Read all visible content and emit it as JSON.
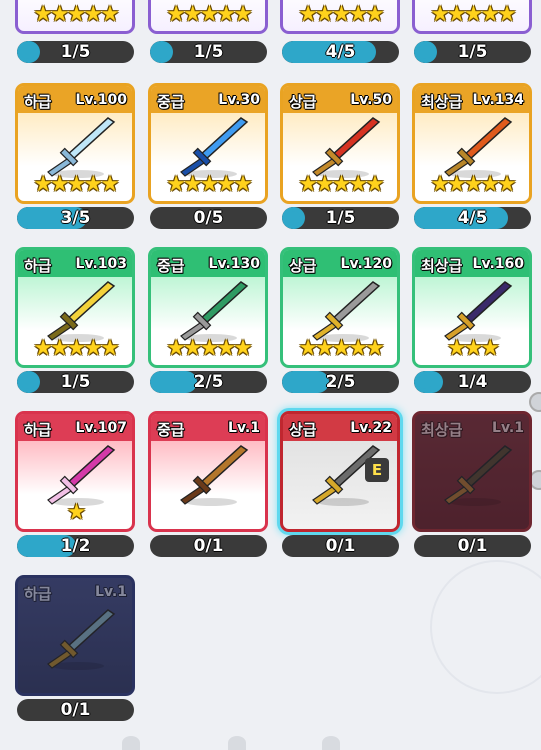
{
  "colors": {
    "purple": "#8a5fd1",
    "orange": "#e9a322",
    "green": "#35c07a",
    "red": "#d9334d",
    "navy": "#2a3260",
    "selected": "#5fd8ee",
    "progress_fill": "#2ea7c9",
    "bar_bg": "#3a3a3a",
    "star": "#ffd21c"
  },
  "top_row": [
    {
      "progress": "1/5",
      "stars": "★★★★★",
      "level": 0.2
    },
    {
      "progress": "1/5",
      "stars": "★★★★★",
      "level": 0.2
    },
    {
      "progress": "4/5",
      "stars": "★★★★★",
      "level": 0.8
    },
    {
      "progress": "1/5",
      "stars": "★★★★★",
      "level": 0.2
    }
  ],
  "weapons": [
    {
      "grade": "하급",
      "level": "Lv.100",
      "stars": "★★★★★",
      "progress": "3/5",
      "fill": 0.6,
      "theme": "orange",
      "icon": "ice-trident-icon",
      "blade": "#bfe6f7",
      "hilt": "#8ab8d8"
    },
    {
      "grade": "중급",
      "level": "Lv.30",
      "stars": "★★★★★",
      "progress": "0/5",
      "fill": 0,
      "theme": "orange",
      "icon": "blue-spear-icon",
      "blade": "#3f9bf0",
      "hilt": "#1a4fa8"
    },
    {
      "grade": "상급",
      "level": "Lv.50",
      "stars": "★★★★★",
      "progress": "1/5",
      "fill": 0.2,
      "theme": "orange",
      "icon": "red-spear-icon",
      "blade": "#d63322",
      "hilt": "#c48a2a"
    },
    {
      "grade": "최상급",
      "level": "Lv.134",
      "stars": "★★★★★",
      "progress": "4/5",
      "fill": 0.8,
      "theme": "orange",
      "icon": "golden-glaive-icon",
      "blade": "#e05a1c",
      "hilt": "#b8862a"
    },
    {
      "grade": "하급",
      "level": "Lv.103",
      "stars": "★★★★★",
      "progress": "1/5",
      "fill": 0.2,
      "theme": "green",
      "icon": "golden-sword-icon",
      "blade": "#f3d23a",
      "hilt": "#7a6a1a"
    },
    {
      "grade": "중급",
      "level": "Lv.130",
      "stars": "★★★★★",
      "progress": "2/5",
      "fill": 0.4,
      "theme": "green",
      "icon": "jade-sword-icon",
      "blade": "#2f9b63",
      "hilt": "#9a9a9a"
    },
    {
      "grade": "상급",
      "level": "Lv.120",
      "stars": "★★★★★",
      "progress": "2/5",
      "fill": 0.4,
      "theme": "green",
      "icon": "gold-blade-icon",
      "blade": "#9a9a9a",
      "hilt": "#e0b22a"
    },
    {
      "grade": "최상급",
      "level": "Lv.160",
      "stars": "★★★",
      "progress": "1/4",
      "fill": 0.25,
      "theme": "green",
      "icon": "dark-sword-icon",
      "blade": "#3a2a6a",
      "hilt": "#d6a02a"
    },
    {
      "grade": "하급",
      "level": "Lv.107",
      "stars": "★",
      "progress": "1/2",
      "fill": 0.5,
      "theme": "red",
      "icon": "pink-staff-icon",
      "blade": "#d43aa8",
      "hilt": "#f2c0e6"
    },
    {
      "grade": "중급",
      "level": "Lv.1",
      "stars": "",
      "progress": "0/1",
      "fill": 0,
      "theme": "red",
      "icon": "bronze-sword-icon",
      "blade": "#b4762a",
      "hilt": "#6a3a1a"
    },
    {
      "grade": "상급",
      "level": "Lv.22",
      "stars": "",
      "progress": "0/1",
      "fill": 0,
      "theme": "grey",
      "icon": "steel-spear-icon",
      "blade": "#6b6b6b",
      "hilt": "#d6a82a",
      "selected": true,
      "badge": "E"
    },
    {
      "grade": "최상급",
      "level": "Lv.1",
      "stars": "",
      "progress": "0/1",
      "fill": 0,
      "theme": "maroon",
      "icon": "shadow-blade-icon",
      "blade": "#4a3a2a",
      "hilt": "#8a5a2a",
      "locked": true
    },
    {
      "grade": "하급",
      "level": "Lv.1",
      "stars": "",
      "progress": "0/1",
      "fill": 0,
      "theme": "navy",
      "icon": "steel-sword-icon",
      "blade": "#6a8a9a",
      "hilt": "#8a6a2a",
      "locked": true
    }
  ]
}
